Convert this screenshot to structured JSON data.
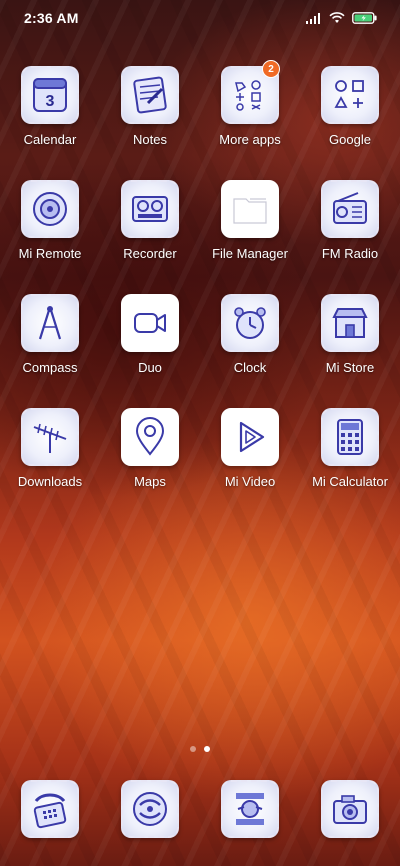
{
  "status_bar": {
    "time": "2:36 AM",
    "icons": [
      "signal-icon",
      "wifi-icon",
      "battery-charging-icon"
    ]
  },
  "apps": [
    {
      "label": "Calendar",
      "icon": "calendar-icon",
      "calendar_day": "3"
    },
    {
      "label": "Notes",
      "icon": "notes-icon"
    },
    {
      "label": "More apps",
      "icon": "folder-icon",
      "badge": "2"
    },
    {
      "label": "Google",
      "icon": "google-folder-icon"
    },
    {
      "label": "Mi Remote",
      "icon": "remote-icon"
    },
    {
      "label": "Recorder",
      "icon": "tape-recorder-icon"
    },
    {
      "label": "File Manager",
      "icon": "folder-icon"
    },
    {
      "label": "FM Radio",
      "icon": "radio-icon"
    },
    {
      "label": "Compass",
      "icon": "compass-icon"
    },
    {
      "label": "Duo",
      "icon": "video-camera-icon"
    },
    {
      "label": "Clock",
      "icon": "alarm-clock-icon"
    },
    {
      "label": "Mi Store",
      "icon": "store-icon"
    },
    {
      "label": "Downloads",
      "icon": "antenna-icon"
    },
    {
      "label": "Maps",
      "icon": "map-pin-icon"
    },
    {
      "label": "Mi Video",
      "icon": "play-icon"
    },
    {
      "label": "Mi Calculator",
      "icon": "calculator-icon"
    }
  ],
  "dock": [
    {
      "icon": "phone-icon"
    },
    {
      "icon": "messages-icon"
    },
    {
      "icon": "badge-emblem-icon"
    },
    {
      "icon": "camera-icon"
    }
  ],
  "pager": {
    "pages": 2,
    "active": 2
  },
  "colors": {
    "ink": "#3a3aa8",
    "badge": "#f06a26"
  }
}
